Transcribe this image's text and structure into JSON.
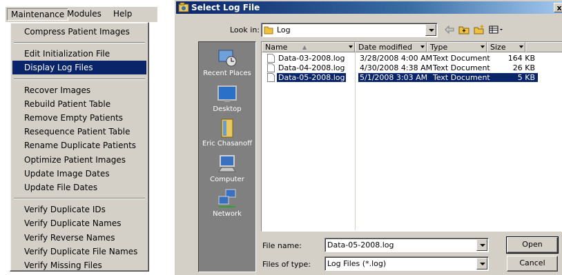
{
  "menubar": {
    "items": [
      "Maintenance",
      "Modules",
      "Help"
    ]
  },
  "menu": {
    "groups": [
      [
        "Compress Patient Images"
      ],
      [
        "Edit Initialization File",
        "Display Log Files"
      ],
      [
        "Recover Images",
        "Rebuild Patient Table",
        "Remove Empty Patients",
        "Resequence Patient Table",
        "Rename Duplicate Patients",
        "Optimize Patient Images",
        "Update Image Dates",
        "Update File Dates"
      ],
      [
        "Verify Duplicate IDs",
        "Verify Duplicate Names",
        "Verify Reverse Names",
        "Verify Duplicate File Names",
        "Verify Missing Files"
      ]
    ],
    "selected": "Display Log Files"
  },
  "dialog": {
    "title": "Select Log File",
    "close": "x",
    "look_in_label": "Look in:",
    "look_in_value": "Log",
    "places": [
      "Recent Places",
      "Desktop",
      "Eric Chasanoff",
      "Computer",
      "Network"
    ],
    "columns": [
      "Name",
      "Date modified",
      "Type",
      "Size"
    ],
    "files": [
      {
        "name": "Data-03-2008.log",
        "date": "3/28/2008 4:00 AM",
        "type": "Text Document",
        "size": "164 KB"
      },
      {
        "name": "Data-04-2008.log",
        "date": "4/30/2008 4:38 AM",
        "type": "Text Document",
        "size": "26 KB"
      },
      {
        "name": "Data-05-2008.log",
        "date": "5/1/2008 3:03 AM",
        "type": "Text Document",
        "size": "5 KB"
      }
    ],
    "selected_file_index": 2,
    "file_name_label": "File name:",
    "file_name_value": "Data-05-2008.log",
    "file_type_label": "Files of type:",
    "file_type_value": "Log Files (*.log)",
    "open_label": "Open",
    "cancel_label": "Cancel"
  },
  "colors": {
    "selection": "#0a246a",
    "face": "#d4d0c8",
    "places_bg": "#808080"
  }
}
